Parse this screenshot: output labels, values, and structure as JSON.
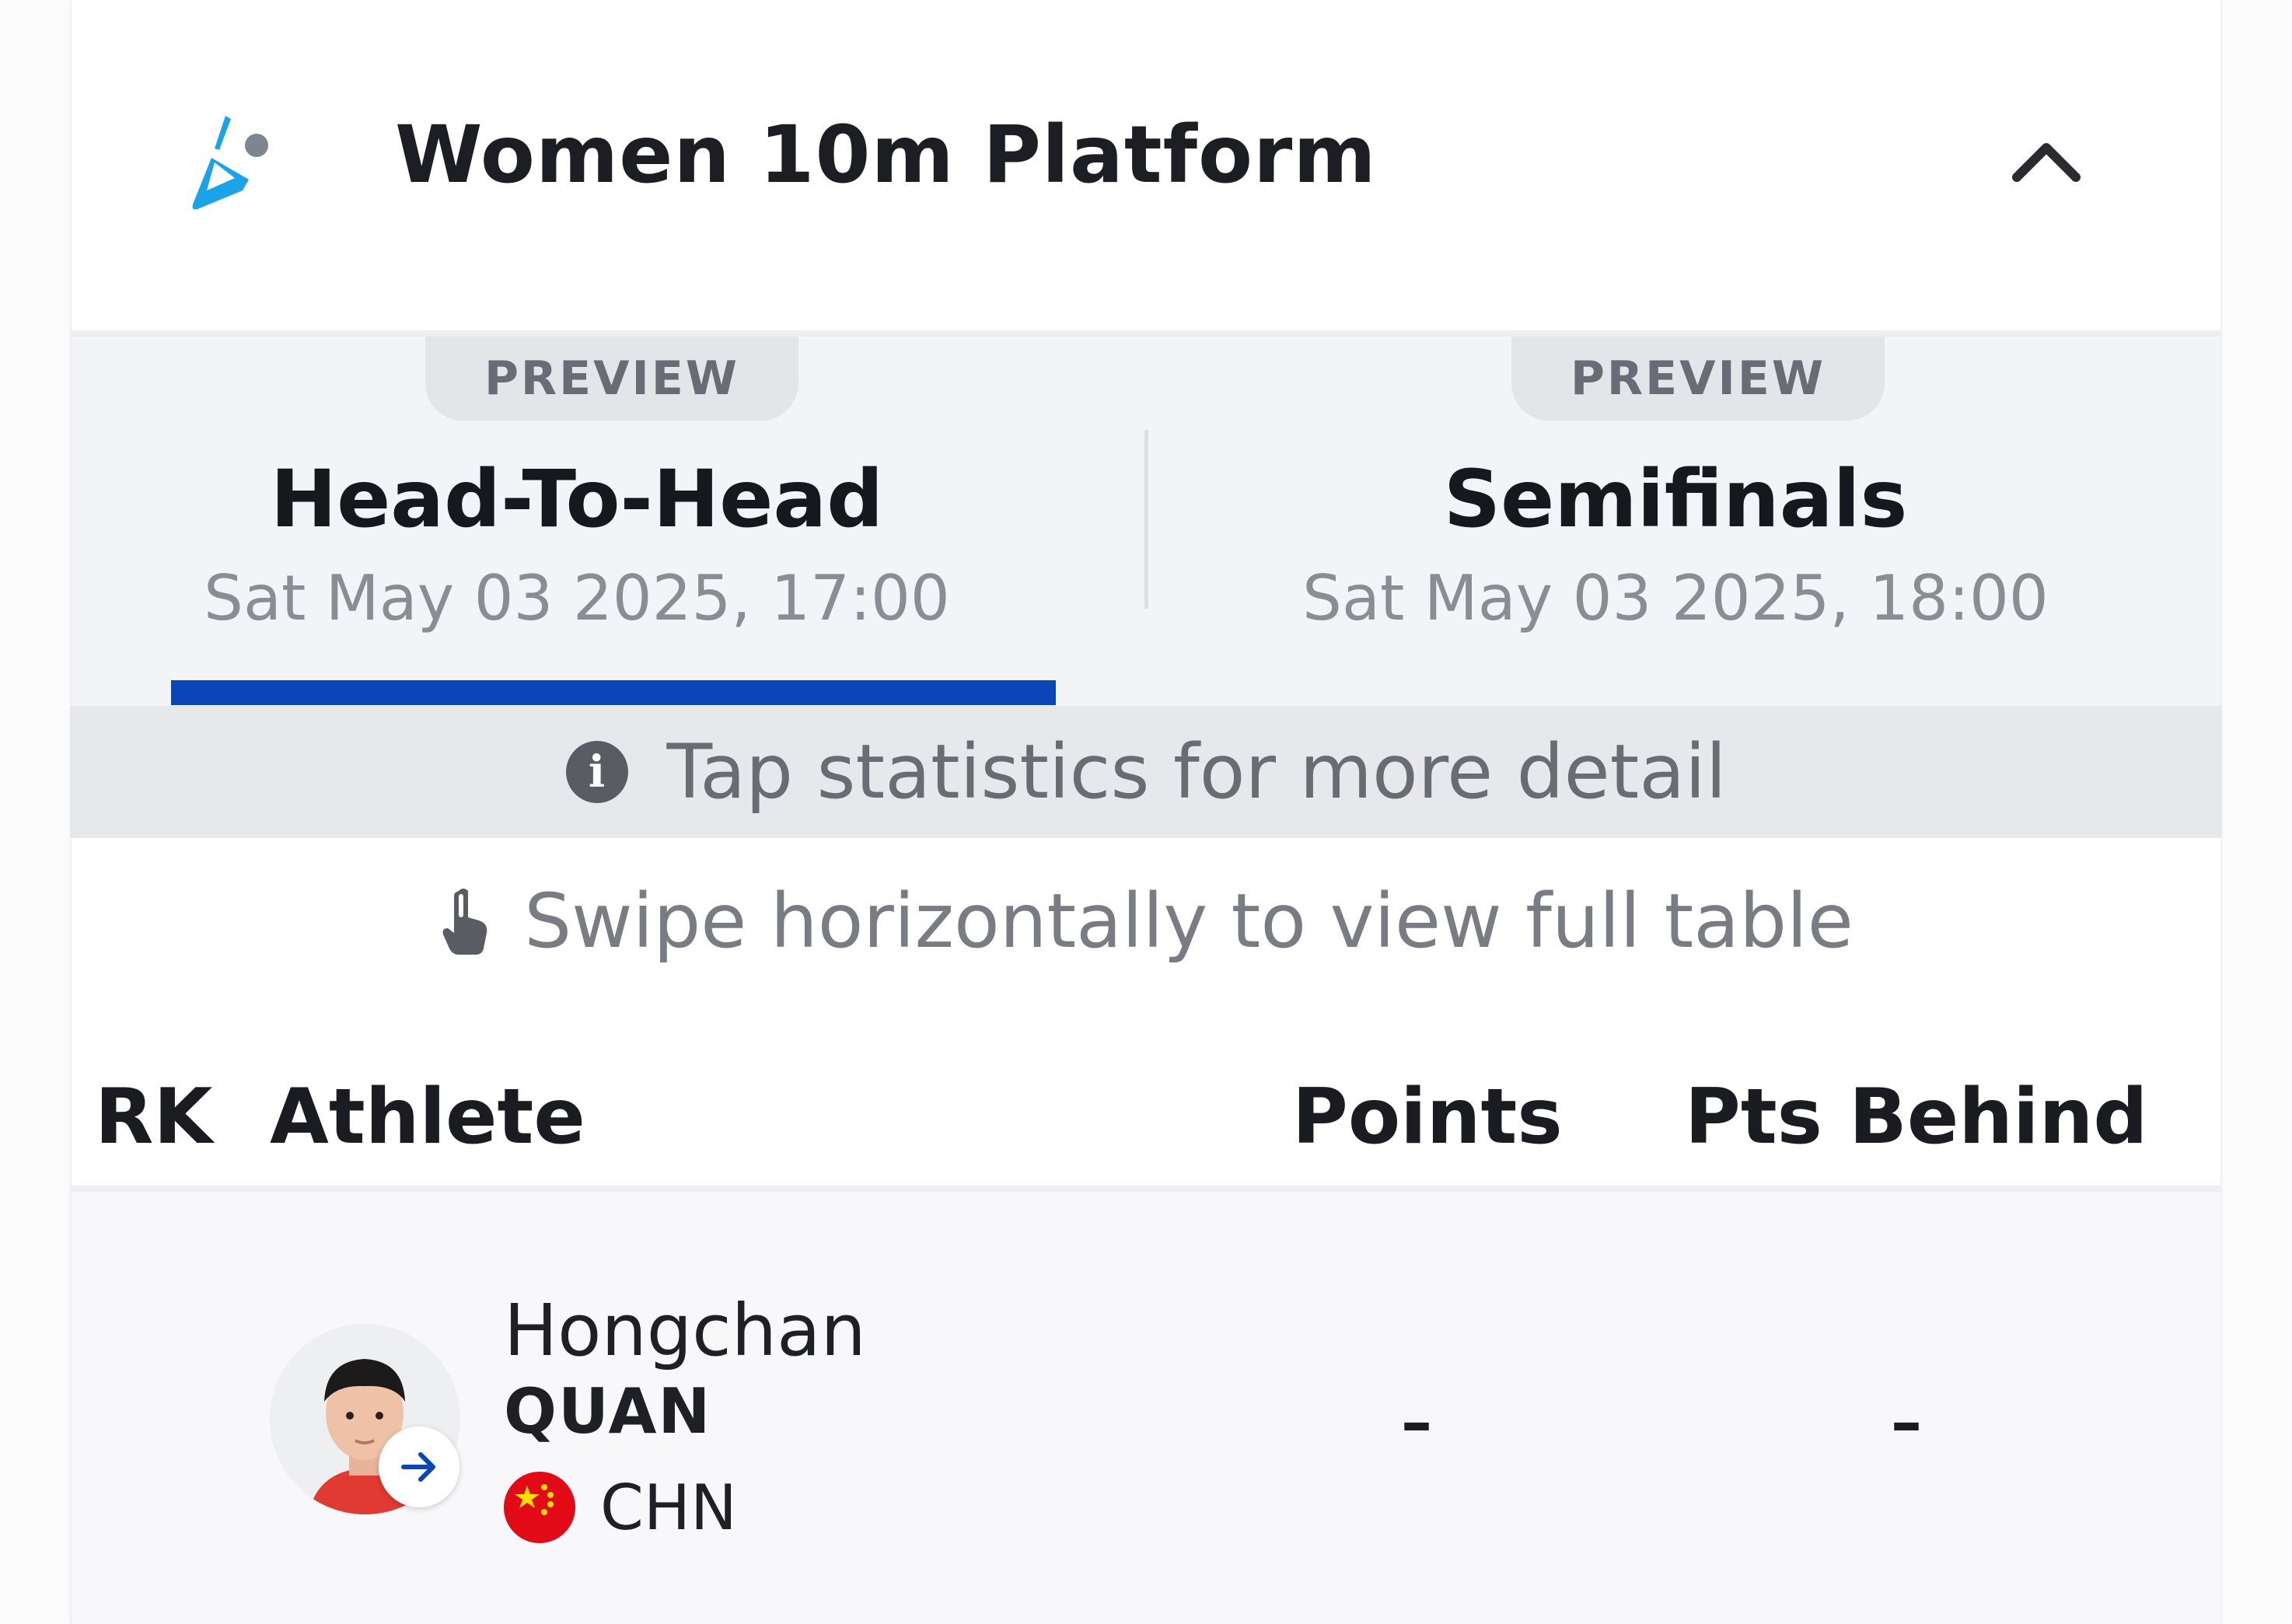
{
  "header": {
    "sport_icon": "diving-icon",
    "event_title": "Women 10m Platform",
    "collapse_icon": "chevron-up-icon"
  },
  "tabs": [
    {
      "badge": "PREVIEW",
      "name": "Head-To-Head",
      "datetime": "Sat May 03 2025, 17:00",
      "selected": true
    },
    {
      "badge": "PREVIEW",
      "name": "Semifinals",
      "datetime": "Sat May 03 2025, 18:00",
      "selected": false
    }
  ],
  "info_banner": {
    "icon": "info-icon",
    "text": "Tap statistics for more detail"
  },
  "swipe_hint": {
    "icon": "hand-pointer-icon",
    "text": "Swipe horizontally to view full table"
  },
  "table": {
    "columns": [
      "RK",
      "Athlete",
      "Points",
      "Pts Behind"
    ],
    "rows": [
      {
        "rank": "",
        "first_name": "Hongchan",
        "last_name": "QUAN",
        "country": "CHN",
        "flag_icon": "china-flag-icon",
        "points": "–",
        "pts_behind": "–"
      }
    ]
  },
  "colors": {
    "accent": "#0b46b8",
    "sport_icon": "#1aa3e8",
    "flag_red": "#e30a17",
    "flag_star": "#ffde00"
  }
}
